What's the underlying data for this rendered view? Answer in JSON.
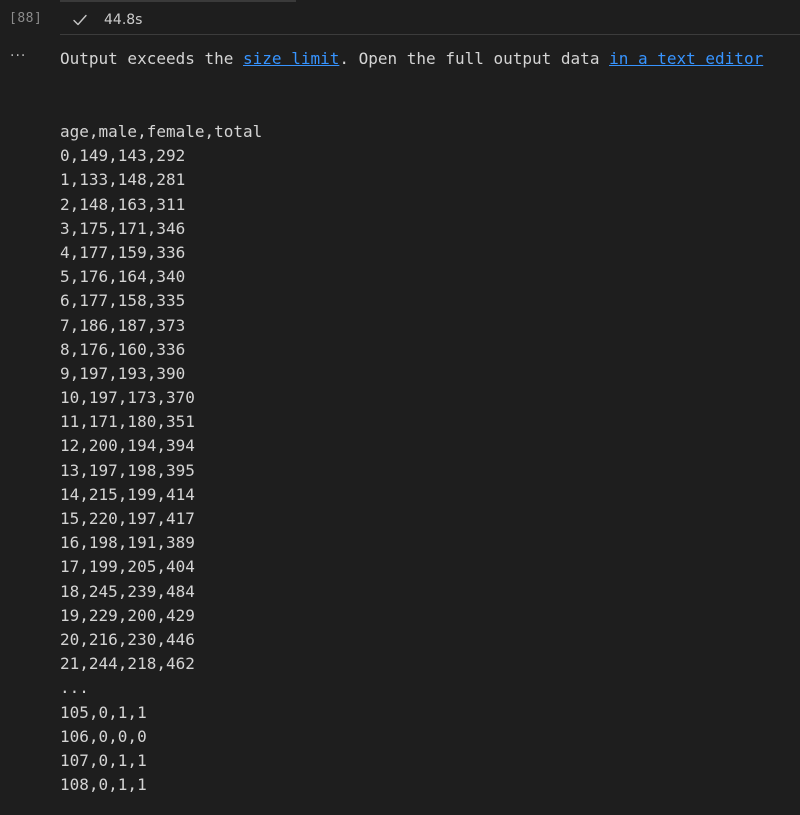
{
  "cell": {
    "execution_count": "[88]",
    "status_icon": "check-icon",
    "duration": "44.8s"
  },
  "output": {
    "more_actions_icon": "ellipsis-icon",
    "more_actions_text": "···",
    "notice": {
      "prefix": "Output exceeds the ",
      "link_size_limit": "size limit",
      "middle": ". Open the full output data ",
      "link_text_editor": "in a text editor"
    },
    "lines": [
      "age,male,female,total",
      "0,149,143,292",
      "1,133,148,281",
      "2,148,163,311",
      "3,175,171,346",
      "4,177,159,336",
      "5,176,164,340",
      "6,177,158,335",
      "7,186,187,373",
      "8,176,160,336",
      "9,197,193,390",
      "10,197,173,370",
      "11,171,180,351",
      "12,200,194,394",
      "13,197,198,395",
      "14,215,199,414",
      "15,220,197,417",
      "16,198,191,389",
      "17,199,205,404",
      "18,245,239,484",
      "19,229,200,429",
      "20,216,230,446",
      "21,244,218,462",
      "...",
      "105,0,1,1",
      "106,0,0,0",
      "107,0,1,1",
      "108,0,1,1"
    ]
  },
  "colors": {
    "background": "#1e1e1e",
    "text": "#d4d4d4",
    "link": "#3794ff",
    "muted": "#8b8b8b"
  }
}
